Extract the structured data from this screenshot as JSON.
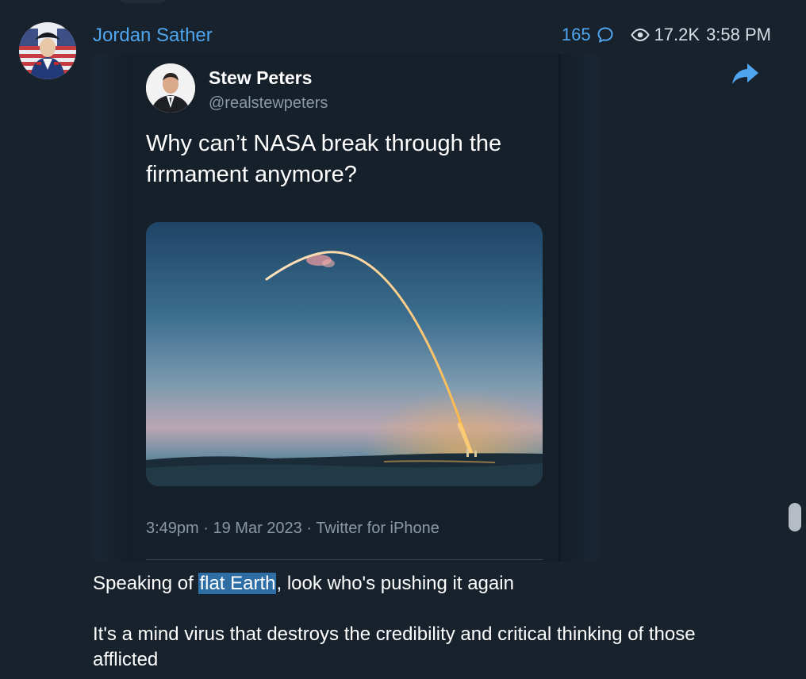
{
  "message": {
    "sender_name": "Jordan Sather",
    "reply_count": "165",
    "views": "17.2K",
    "time": "3:58 PM"
  },
  "tweet": {
    "author_name": "Stew Peters",
    "author_handle": "@realstewpeters",
    "text": "Why can’t NASA break through the firmament anymore?",
    "footer": "3:49pm · 19 Mar 2023 · Twitter for iPhone"
  },
  "caption": {
    "line1_before": "Speaking of ",
    "line1_highlight": "flat Earth",
    "line1_after": ", look who's pushing it again",
    "line2": "It's a mind virus that destroys the credibility and critical thinking of those afflicted"
  },
  "colors": {
    "background": "#18222d",
    "accent": "#4fa6ee",
    "selection": "#2f6ea5",
    "muted_text": "#8b98a5"
  },
  "icons": {
    "reply": "speech-bubble-icon",
    "views": "eye-icon",
    "forward": "share-arrow-icon"
  }
}
